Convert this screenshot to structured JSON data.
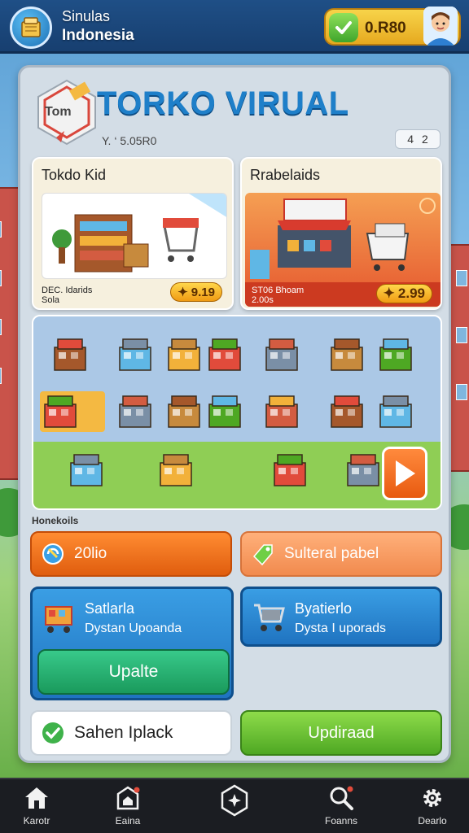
{
  "header": {
    "app_name_line1": "Sinulas",
    "app_name_line2": "Indonesia",
    "coins": "0.R80"
  },
  "main": {
    "title": "TORKO VIRUAL",
    "logo_text": "Tom",
    "sub_value": "Y. ‘ 5.05R0",
    "level_prefix": "4",
    "level_value": "2"
  },
  "cards": [
    {
      "title": "Tokdo Kid",
      "price": "9.19",
      "sub1": "DEC. Idarids",
      "sub2": "Sola"
    },
    {
      "title": "Rrabelaids",
      "price": "2.99",
      "sub1": "ST06 Bhoam",
      "sub2": "2.00s"
    }
  ],
  "section_label": "Honekoils",
  "buttons": {
    "orange": "20lio",
    "peach": "Sulteral pabel",
    "white": "Sahen Iplack",
    "green": "Updiraad"
  },
  "blue_cards": [
    {
      "line1": "Satlarla",
      "line2": "Dystan Upoanda",
      "button": "Upalte"
    },
    {
      "line1": "Byatierlo",
      "line2": "Dysta I uporads"
    }
  ],
  "nav": [
    {
      "label": "Karotr",
      "icon": "home-icon"
    },
    {
      "label": "Eaina",
      "icon": "store-icon"
    },
    {
      "label": "",
      "icon": "compass-icon"
    },
    {
      "label": "Foanns",
      "icon": "search-icon"
    },
    {
      "label": "Dearlo",
      "icon": "gear-icon"
    }
  ],
  "colors": {
    "topbar": "#1f4f86",
    "title_blue": "#1e7fc9",
    "coin_gold": "#f7d44a",
    "orange_button": "#ff8c32",
    "green_button": "#4ea823",
    "nav_bg": "#1b1d22"
  }
}
